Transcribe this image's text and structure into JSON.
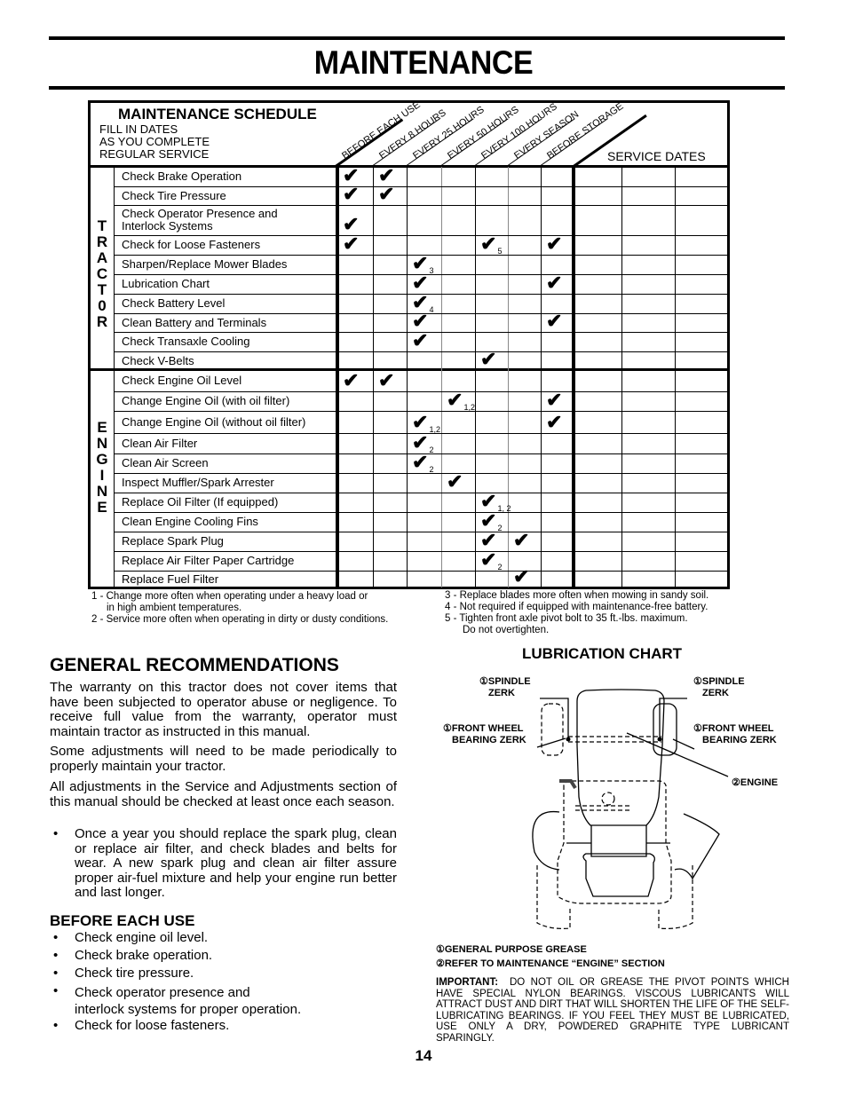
{
  "page": {
    "title": "MAINTENANCE",
    "page_number": "14"
  },
  "schedule": {
    "title": "MAINTENANCE SCHEDULE",
    "subtitle": [
      "FILL IN DATES",
      "AS YOU COMPLETE",
      "REGULAR SERVICE"
    ],
    "intervals": [
      "BEFORE EACH USE",
      "EVERY 8 HOURS",
      "EVERY 25 HOURS",
      "EVERY 50 HOURS",
      "EVERY 100 HOURS",
      "EVERY SEASON",
      "BEFORE STORAGE"
    ],
    "service_dates_label": "SERVICE DATES",
    "check_glyph": "✔",
    "sections": [
      {
        "name": "TRACTOR",
        "letters": [
          "T",
          "R",
          "A",
          "C",
          "T",
          "0",
          "R"
        ],
        "tasks": [
          {
            "label": "Check Brake Operation",
            "checks": [
              {
                "col": 0,
                "note": ""
              },
              {
                "col": 1,
                "note": ""
              }
            ]
          },
          {
            "label": "Check Tire Pressure",
            "checks": [
              {
                "col": 0,
                "note": ""
              },
              {
                "col": 1,
                "note": ""
              }
            ]
          },
          {
            "label": "Check Operator Presence and Interlock Systems",
            "label_lines": [
              "Check Operator Presence and",
              "Interlock Systems"
            ],
            "checks": [
              {
                "col": 0,
                "note": ""
              }
            ]
          },
          {
            "label": "Check for Loose Fasteners",
            "checks": [
              {
                "col": 0,
                "note": ""
              },
              {
                "col": 4,
                "note": "5"
              },
              {
                "col": 6,
                "note": ""
              }
            ]
          },
          {
            "label": "Sharpen/Replace Mower Blades",
            "checks": [
              {
                "col": 2,
                "note": "3"
              }
            ]
          },
          {
            "label": "Lubrication Chart",
            "checks": [
              {
                "col": 2,
                "note": ""
              },
              {
                "col": 6,
                "note": ""
              }
            ]
          },
          {
            "label": "Check Battery Level",
            "checks": [
              {
                "col": 2,
                "note": "4"
              }
            ]
          },
          {
            "label": "Clean Battery and Terminals",
            "checks": [
              {
                "col": 2,
                "note": ""
              },
              {
                "col": 6,
                "note": ""
              }
            ]
          },
          {
            "label": "Check Transaxle Cooling",
            "checks": [
              {
                "col": 2,
                "note": ""
              }
            ]
          },
          {
            "label": "Check V-Belts",
            "checks": [
              {
                "col": 4,
                "note": ""
              }
            ]
          }
        ]
      },
      {
        "name": "ENGINE",
        "letters": [
          "E",
          "N",
          "G",
          "I",
          "N",
          "E"
        ],
        "tasks": [
          {
            "label": "Check Engine Oil Level",
            "checks": [
              {
                "col": 0,
                "note": ""
              },
              {
                "col": 1,
                "note": ""
              }
            ]
          },
          {
            "label": "Change Engine Oil (with oil filter)",
            "checks": [
              {
                "col": 3,
                "note": "1,2"
              },
              {
                "col": 6,
                "note": ""
              }
            ]
          },
          {
            "label": "Change Engine Oil (without oil filter)",
            "checks": [
              {
                "col": 2,
                "note": "1,2"
              },
              {
                "col": 6,
                "note": ""
              }
            ]
          },
          {
            "label": "Clean Air Filter",
            "checks": [
              {
                "col": 2,
                "note": "2"
              }
            ]
          },
          {
            "label": "Clean Air Screen",
            "checks": [
              {
                "col": 2,
                "note": "2"
              }
            ]
          },
          {
            "label": "Inspect Muffler/Spark Arrester",
            "checks": [
              {
                "col": 3,
                "note": ""
              }
            ]
          },
          {
            "label": "Replace Oil Filter (If equipped)",
            "checks": [
              {
                "col": 4,
                "note": "1, 2"
              }
            ]
          },
          {
            "label": "Clean Engine Cooling Fins",
            "checks": [
              {
                "col": 4,
                "note": "2"
              }
            ]
          },
          {
            "label": "Replace Spark Plug",
            "checks": [
              {
                "col": 4,
                "note": ""
              },
              {
                "col": 5,
                "note": ""
              }
            ]
          },
          {
            "label": "Replace Air Filter Paper Cartridge",
            "checks": [
              {
                "col": 4,
                "note": "2"
              }
            ]
          },
          {
            "label": "Replace Fuel Filter",
            "checks": [
              {
                "col": 5,
                "note": ""
              }
            ]
          }
        ]
      }
    ],
    "footnotes_left": [
      {
        "line1": "1 - Change more often when operating under a heavy load or",
        "line2": "in high ambient temperatures."
      },
      {
        "line1": "2 - Service more often when operating in dirty or dusty conditions.",
        "line2": ""
      }
    ],
    "footnotes_right": [
      {
        "line1": "3 - Replace blades more often when mowing in sandy soil.",
        "line2": ""
      },
      {
        "line1": "4 - Not required if equipped with maintenance-free battery.",
        "line2": ""
      },
      {
        "line1": "5 - Tighten front axle pivot bolt to 35 ft.-lbs. maximum.",
        "line2": "Do not overtighten."
      }
    ]
  },
  "general": {
    "heading": "GENERAL RECOMMENDATIONS",
    "paragraphs": [
      "The warranty on this tractor does not cover items that have been subjected to operator abuse or negligence. To receive full value from the warranty, operator must maintain tractor as instructed in this manual.",
      "Some adjustments will need to be made periodically to properly maintain your tractor.",
      "All adjustments in the Service and Adjustments section of this manual should be checked at least once each season."
    ],
    "bullet": "Once a year you should replace the spark plug, clean or replace air filter, and check blades and belts for wear. A new spark plug and clean air filter assure proper air-fuel mixture and help your engine run better and last longer."
  },
  "before_each_use": {
    "heading": "BEFORE EACH USE",
    "items": [
      "Check engine oil level.",
      "Check brake operation.",
      "Check tire pressure.",
      "Check operator presence and interlock systems for proper operation.",
      "Check for loose fasteners."
    ],
    "item4_lines": [
      "Check operator presence and",
      "interlock systems for proper operation."
    ]
  },
  "lubrication": {
    "heading": "LUBRICATION CHART",
    "labels": {
      "spindle_left": [
        "①SPINDLE",
        "ZERK"
      ],
      "spindle_right": [
        "①SPINDLE",
        "ZERK"
      ],
      "bearing_left": [
        "①FRONT WHEEL",
        "BEARING  ZERK"
      ],
      "bearing_right": [
        "①FRONT WHEEL",
        "BEARING  ZERK"
      ],
      "engine": "②ENGINE"
    },
    "legend": [
      "①GENERAL PURPOSE GREASE",
      "②REFER TO MAINTENANCE “ENGINE” SECTION"
    ],
    "important_label": "IMPORTANT:",
    "important_text": "DO NOT OIL OR GREASE THE PIVOT POINTS WHICH HAVE SPECIAL NYLON BEARINGS.  VISCOUS LUBRICANTS WILL ATTRACT DUST AND DIRT THAT WILL SHORTEN THE LIFE OF THE SELF-LUBRICATING BEARINGS. IF YOU FEEL THEY MUST BE LUBRICATED, USE ONLY A DRY, POWDERED GRAPHITE TYPE LUBRICANT SPARINGLY."
  }
}
